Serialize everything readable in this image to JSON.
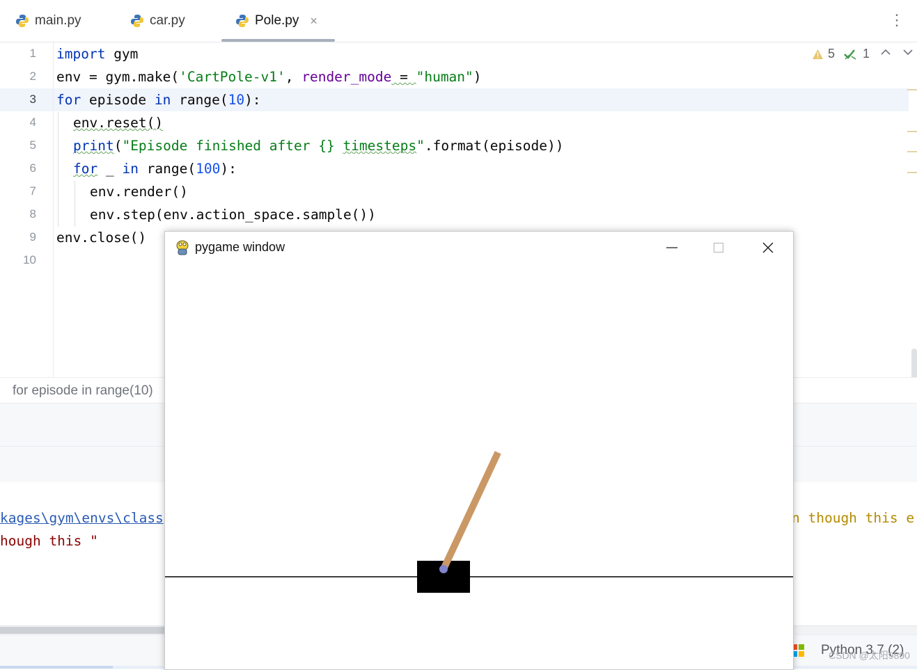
{
  "tabs": [
    {
      "label": "main.py",
      "icon": "python-icon"
    },
    {
      "label": "car.py",
      "icon": "python-icon"
    },
    {
      "label": "Pole.py",
      "icon": "python-icon",
      "active": true
    }
  ],
  "tab_close_symbol": "×",
  "tab_menu_symbol": "⋮",
  "editor": {
    "line_numbers": [
      "1",
      "2",
      "3",
      "4",
      "5",
      "6",
      "7",
      "8",
      "9",
      "10"
    ],
    "current_line": 3,
    "lines": {
      "l1_kw": "import",
      "l1_rest": " gym",
      "l2_a": "env = gym.make(",
      "l2_str": "'CartPole-v1'",
      "l2_b": ", ",
      "l2_param": "render_mode",
      "l2_eq": " = ",
      "l2_str2": "\"human\"",
      "l2_c": ")",
      "l3_kw": "for",
      "l3_a": " episode ",
      "l3_kw2": "in",
      "l3_b": " range(",
      "l3_num": "10",
      "l3_c": "):",
      "l4": "env.reset()",
      "l5_fn": "print",
      "l5_a": "(",
      "l5_str": "\"Episode finished after {} ",
      "l5_str2": "timesteps",
      "l5_str3": "\"",
      "l5_b": ".format(episode))",
      "l6_kw": "for",
      "l6_a": " _ ",
      "l6_kw2": "in",
      "l6_b": " range(",
      "l6_num": "100",
      "l6_c": "):",
      "l7": "env.render()",
      "l8": "env.step(env.action_space.sample())",
      "l9": "env.close()"
    },
    "inspections": {
      "warnings": "5",
      "weak_warnings": "1"
    }
  },
  "breadcrumb": "for episode in range(10)",
  "console": {
    "line1_link": "kages\\gym\\envs\\class",
    "line1_right": "n though this e",
    "line2": "hough this \""
  },
  "statusbar": {
    "interpreter": "Python 3.7 (2)",
    "watermark": "CSDN @太阳9890"
  },
  "pygame_window": {
    "title": "pygame window",
    "pole_angle_deg_from_vertical": 25,
    "colors": {
      "cart": "#000000",
      "pole": "#ca9865",
      "axle": "#8184cb",
      "track": "#000000",
      "bg": "#ffffff"
    }
  },
  "colors": {
    "keyword": "#0033b3",
    "string": "#067d17",
    "number": "#1750eb",
    "param": "#660099",
    "link": "#2a5bb4",
    "error_text": "#8b0000",
    "warn_text": "#b48a00"
  }
}
